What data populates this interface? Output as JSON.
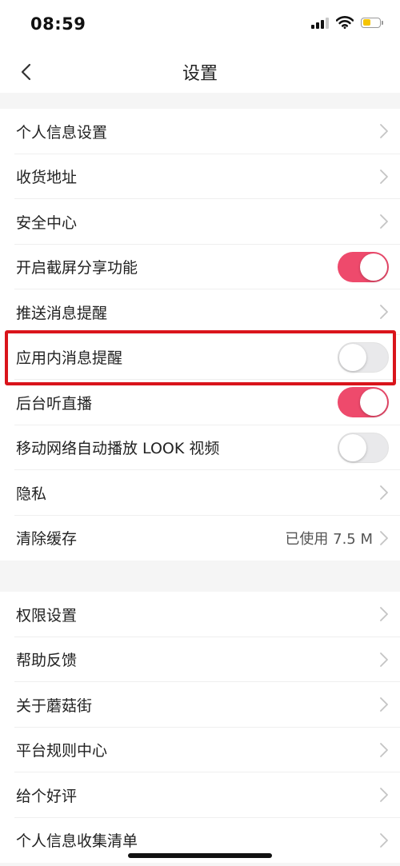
{
  "status_bar": {
    "time": "08:59",
    "battery_color": "#f5c400"
  },
  "nav": {
    "title": "设置",
    "back_icon": "chevron-left-icon"
  },
  "accent_color": "#ee4a6c",
  "highlight_color": "#d9141b",
  "group1": [
    {
      "label": "个人信息设置",
      "type": "link"
    },
    {
      "label": "收货地址",
      "type": "link"
    },
    {
      "label": "安全中心",
      "type": "link"
    },
    {
      "label": "开启截屏分享功能",
      "type": "toggle",
      "on": true
    },
    {
      "label": "推送消息提醒",
      "type": "link"
    },
    {
      "label": "应用内消息提醒",
      "type": "toggle",
      "on": false,
      "highlighted": true
    },
    {
      "label": "后台听直播",
      "type": "toggle",
      "on": true
    },
    {
      "label": "移动网络自动播放 LOOK 视频",
      "type": "toggle",
      "on": false
    },
    {
      "label": "隐私",
      "type": "link"
    },
    {
      "label": "清除缓存",
      "type": "link",
      "value": "已使用 7.5 M"
    }
  ],
  "group2": [
    {
      "label": "权限设置",
      "type": "link"
    },
    {
      "label": "帮助反馈",
      "type": "link"
    },
    {
      "label": "关于蘑菇街",
      "type": "link"
    },
    {
      "label": "平台规则中心",
      "type": "link"
    },
    {
      "label": "给个好评",
      "type": "link"
    },
    {
      "label": "个人信息收集清单",
      "type": "link"
    }
  ]
}
